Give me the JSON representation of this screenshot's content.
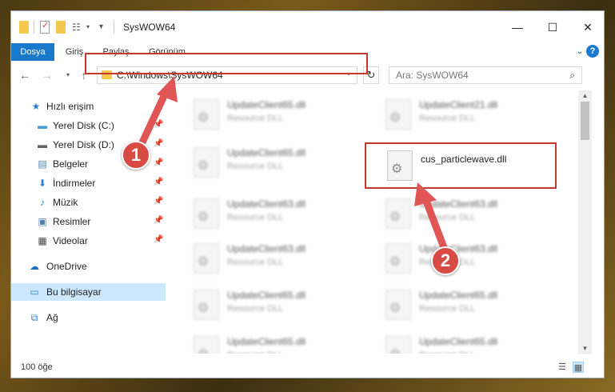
{
  "window": {
    "title": "SysWOW64",
    "minimize": "—",
    "maximize": "☐",
    "close": "✕"
  },
  "ribbon": {
    "tabs": [
      {
        "label": "Dosya",
        "active": true
      },
      {
        "label": "Giriş",
        "active": false
      },
      {
        "label": "Paylaş",
        "active": false
      },
      {
        "label": "Görünüm",
        "active": false
      }
    ],
    "help": "?"
  },
  "nav": {
    "address": "C:\\Windows\\SysWOW64",
    "search_placeholder": "Ara: SysWOW64"
  },
  "sidebar": {
    "items": [
      {
        "label": "Hızlı erişim",
        "icon": "star-icon"
      },
      {
        "label": "Yerel Disk (C:)",
        "icon": "drive-icon"
      },
      {
        "label": "Yerel Disk (D:)",
        "icon": "drive-icon"
      },
      {
        "label": "Belgeler",
        "icon": "documents-icon"
      },
      {
        "label": "İndirmeler",
        "icon": "download-icon"
      },
      {
        "label": "Müzik",
        "icon": "music-icon"
      },
      {
        "label": "Resimler",
        "icon": "pictures-icon"
      },
      {
        "label": "Videolar",
        "icon": "video-icon"
      },
      {
        "label": "OneDrive",
        "icon": "cloud-icon"
      },
      {
        "label": "Bu bilgisayar",
        "icon": "computer-icon"
      },
      {
        "label": "Ağ",
        "icon": "network-icon"
      }
    ]
  },
  "files": {
    "left": [
      {
        "name": "UpdateClient65.dll",
        "type": "Resource DLL"
      },
      {
        "name": "UpdateClient65.dll",
        "type": "Resource DLL"
      },
      {
        "name": "UpdateClient63.dll",
        "type": "Resource DLL"
      },
      {
        "name": "UpdateClient63.dll",
        "type": "Resource DLL"
      },
      {
        "name": "UpdateClient65.dll",
        "type": "Resource DLL"
      },
      {
        "name": "UpdateClient65.dll",
        "type": "Resource DLL"
      }
    ],
    "right": [
      {
        "name": "UpdateClient21.dll",
        "type": "Resource DLL"
      },
      {
        "name": "cus_particlewave.dll",
        "type": ""
      },
      {
        "name": "UpdateClient63.dll",
        "type": "Resource DLL"
      },
      {
        "name": "UpdateClient63.dll",
        "type": "Resource DLL"
      },
      {
        "name": "UpdateClient65.dll",
        "type": "Resource DLL"
      },
      {
        "name": "UpdateClient65.dll",
        "type": "Resource DLL"
      }
    ]
  },
  "status": {
    "count": "100 öğe"
  },
  "annotations": {
    "step1": "1",
    "step2": "2",
    "color": "#d84b45"
  }
}
